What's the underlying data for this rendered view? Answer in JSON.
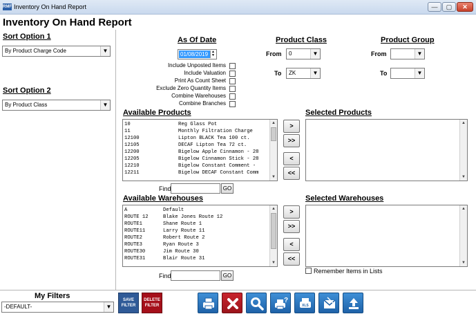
{
  "window": {
    "title": "Inventory On Hand Report",
    "app_icon_text": "RMF",
    "minimize": "—",
    "maximize": "▢",
    "close": "✕"
  },
  "header": {
    "title": "Inventory On Hand Report"
  },
  "sort": {
    "option1_label": "Sort Option 1",
    "option1_value": "By Product Charge Code",
    "option2_label": "Sort Option 2",
    "option2_value": "By Product Class"
  },
  "as_of": {
    "label": "As Of Date",
    "date": "01/08/2019",
    "options": [
      {
        "label": "Include Unposted Items",
        "checked": false
      },
      {
        "label": "Include Valuation",
        "checked": false
      },
      {
        "label": "Print As Count Sheet",
        "checked": false
      },
      {
        "label": "Exclude Zero Quantity Items",
        "checked": false
      },
      {
        "label": "Combine Warehouses",
        "checked": false
      },
      {
        "label": "Combine Branches",
        "checked": false
      }
    ]
  },
  "product_class": {
    "label": "Product Class",
    "from_label": "From",
    "from_value": "0",
    "to_label": "To",
    "to_value": "ZK"
  },
  "product_group": {
    "label": "Product Group",
    "from_label": "From",
    "from_value": "",
    "to_label": "To",
    "to_value": ""
  },
  "available_products": {
    "label": "Available Products",
    "items": [
      {
        "code": "10",
        "desc": "Reg Glass Pot"
      },
      {
        "code": "11",
        "desc": "Monthly Filtration Charge"
      },
      {
        "code": "12100",
        "desc": "Lipton BLACK Tea 100 ct."
      },
      {
        "code": "12105",
        "desc": "DECAF Lipton Tea 72 ct."
      },
      {
        "code": "12200",
        "desc": "Bigelow Apple Cinnamon - 28"
      },
      {
        "code": "12205",
        "desc": "Bigelow Cinnamon Stick - 28"
      },
      {
        "code": "12210",
        "desc": "Bigelow Constant Comment -"
      },
      {
        "code": "12211",
        "desc": "Bigelow DECAF Constant Comm"
      }
    ]
  },
  "selected_products": {
    "label": "Selected Products"
  },
  "available_warehouses": {
    "label": "Available Warehouses",
    "items": [
      {
        "code": "A",
        "desc": "Default"
      },
      {
        "code": "ROUTE 12",
        "desc": "Blake Jones Route 12"
      },
      {
        "code": "ROUTE1",
        "desc": "Shane Route 1"
      },
      {
        "code": "ROUTE11",
        "desc": "Larry Route 11"
      },
      {
        "code": "ROUTE2",
        "desc": "Robert Route 2"
      },
      {
        "code": "ROUTE3",
        "desc": "Ryan Route 3"
      },
      {
        "code": "ROUTE30",
        "desc": "Jim Route 30"
      },
      {
        "code": "ROUTE31",
        "desc": "Blair Route 31"
      }
    ]
  },
  "selected_warehouses": {
    "label": "Selected Warehouses"
  },
  "move_buttons": {
    "add": ">",
    "add_all": ">>",
    "remove": "<",
    "remove_all": "<<"
  },
  "find": {
    "label": "Find",
    "go": "GO"
  },
  "remember_label": "Remember Items in Lists",
  "filters": {
    "label": "My Filters",
    "value": "-DEFAULT-",
    "save_label_1": "SAVE",
    "save_label_2": "FILTER",
    "delete_label_1": "DELETE",
    "delete_label_2": "FILTER"
  },
  "toolbar": {
    "icons": [
      "print-icon",
      "cancel-icon",
      "preview-icon",
      "print-setup-icon",
      "export-icon",
      "email-icon",
      "upload-icon"
    ],
    "export_text": "XLS"
  },
  "colors": {
    "accent_blue": "#2a74c0",
    "danger_red": "#b3141f",
    "selection": "#3399ff"
  }
}
